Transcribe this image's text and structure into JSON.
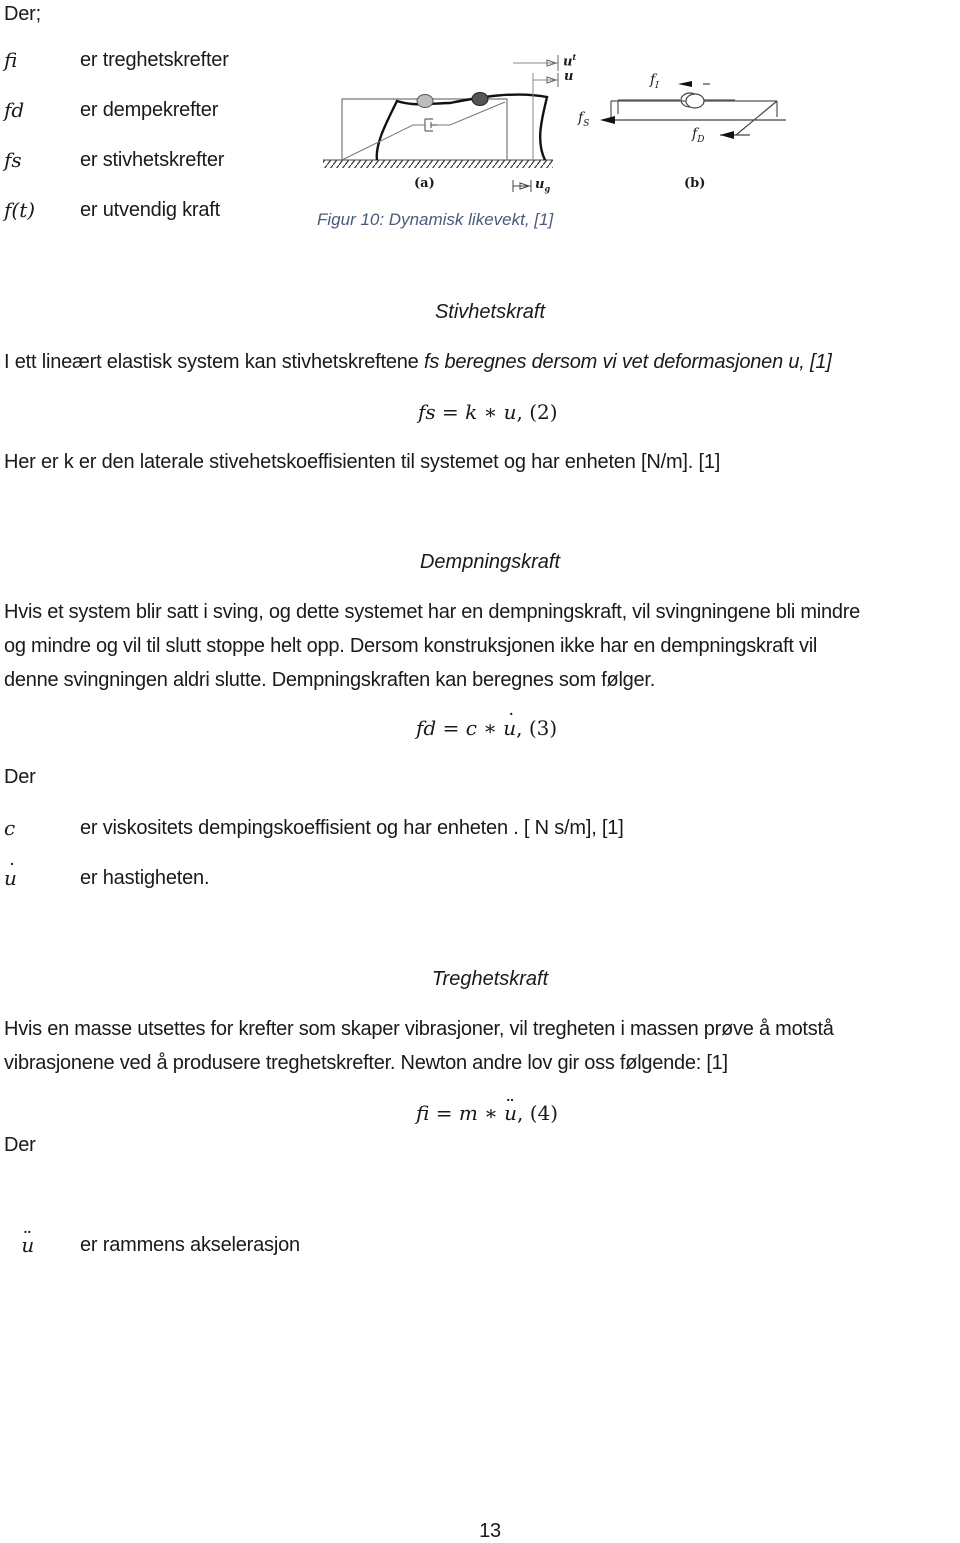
{
  "intro": {
    "der_label": "Der;",
    "definitions": [
      {
        "symbol": "fi",
        "text": "er treghetskrefter"
      },
      {
        "symbol": "fd",
        "text": "er dempekrefter"
      },
      {
        "symbol": "fs",
        "text": "er stivhetskrefter"
      },
      {
        "symbol": "f(t)",
        "text": "er utvendig kraft"
      }
    ]
  },
  "figure": {
    "caption": "Figur 10: Dynamisk likevekt, [1]",
    "panel_a_label": "(a)",
    "panel_b_label": "(b)",
    "labels": {
      "u_total": "u",
      "u_total_sup": "t",
      "u": "u",
      "u_g": "u",
      "u_g_sub": "g",
      "f_s": "f",
      "f_s_sub": "S",
      "f_i": "f",
      "f_i_sub": "I",
      "f_d": "f",
      "f_d_sub": "D"
    }
  },
  "stiffness": {
    "heading": "Stivhetskraft",
    "intro_plain": "I ett lineært elastisk system kan stivhetskreftene ",
    "intro_italic": "fs beregnes dersom vi vet deformasjonen u, [1]",
    "equation_lhs": "fs",
    "equation_rhs_var1": "k",
    "equation_rhs_var2": "u",
    "equation_number": "(2)",
    "explanation": "Her er k er den laterale stivehetskoeffisienten til systemet og har enheten [N/m]. [1]"
  },
  "damping": {
    "heading": "Dempningskraft",
    "paragraph_lines": [
      "Hvis et system blir satt i sving, og dette systemet har en dempningskraft, vil svingningene bli mindre",
      "og mindre og vil til slutt stoppe helt opp. Dersom konstruksjonen ikke har en dempningskraft vil",
      "denne svingningen aldri slutte. Dempningskraften kan beregnes som følger."
    ],
    "equation_lhs": "fd",
    "equation_rhs_var1": "c",
    "equation_rhs_var2": "u",
    "equation_number": "(3)",
    "der_label": "Der",
    "definitions": [
      {
        "symbol": "c",
        "text": "er viskositets dempingskoeffisient og har enheten . [ N s/m], [1]"
      },
      {
        "symbol": "u",
        "text": "er hastigheten."
      }
    ]
  },
  "inertia": {
    "heading": "Treghetskraft",
    "paragraph_lines": [
      "Hvis en masse utsettes for krefter som skaper vibrasjoner, vil tregheten i massen prøve å motstå",
      "vibrasjonene ved å produsere treghetskrefter. Newton andre lov gir oss følgende: [1]"
    ],
    "equation_lhs": "fi",
    "equation_rhs_var1": "m",
    "equation_rhs_var2": "u",
    "equation_number": "(4)",
    "der_label": "Der",
    "definitions": [
      {
        "symbol": "u",
        "text": "er rammens akselerasjon"
      }
    ]
  },
  "footer": {
    "page_number": "13"
  }
}
